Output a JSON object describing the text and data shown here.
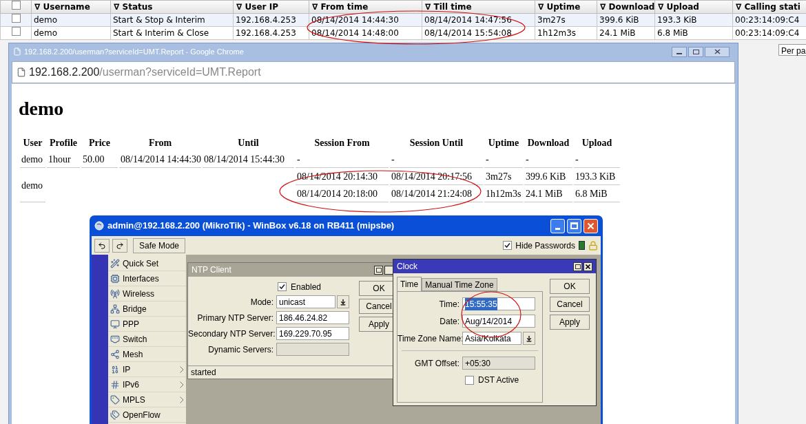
{
  "user_list": {
    "header_checkbox": {
      "checked": false
    },
    "columns": [
      "∇ Username",
      "∇ Status",
      "∇ User IP",
      "∇ From time",
      "∇ Till time",
      "∇ Uptime",
      "∇ Download",
      "∇ Upload",
      "∇ Calling stati"
    ],
    "rows": [
      {
        "checked": false,
        "cells": [
          "demo",
          "Start & Stop & Interim",
          "192.168.4.253",
          "08/14/2014 14:44:30",
          "08/14/2014 14:47:56",
          "3m27s",
          "399.6 KiB",
          "193.3 KiB",
          "00:23:14:09:C4"
        ]
      },
      {
        "checked": false,
        "cells": [
          "demo",
          "Start & Interim & Close",
          "192.168.4.253",
          "08/14/2014 14:48:00",
          "08/14/2014 15:54:08",
          "1h12m3s",
          "24.1 MiB",
          "6.8 MiB",
          "00:23:14:09:C4"
        ]
      }
    ]
  },
  "side_panel": {
    "per_page": "Per pa"
  },
  "browser": {
    "title": "192.168.2.200/userman?serviceId=UMT.Report - Google Chrome",
    "address": {
      "host": "192.168.2.200",
      "path": "/userman?serviceId=UMT.Report"
    },
    "report": {
      "heading": "demo",
      "columns": [
        "User",
        "Profile",
        "Price",
        "From",
        "Until",
        "Session From",
        "Session Until",
        "Uptime",
        "Download",
        "Upload"
      ],
      "rows": [
        {
          "user": "demo",
          "profile": "1hour",
          "price": "50.00",
          "from": "08/14/2014 14:44:30",
          "until": "08/14/2014 15:44:30",
          "sessions": [
            {
              "from": "-",
              "until": "-",
              "uptime": "-",
              "download": "-",
              "upload": "-"
            }
          ]
        },
        {
          "user": "demo",
          "sessions": [
            {
              "from": "08/14/2014 20:14:30",
              "until": "08/14/2014 20:17:56",
              "uptime": "3m27s",
              "download": "399.6 KiB",
              "upload": "193.3 KiB"
            },
            {
              "from": "08/14/2014 20:18:00",
              "until": "08/14/2014 21:24:08",
              "uptime": "1h12m3s",
              "download": "24.1 MiB",
              "upload": "6.8 MiB"
            }
          ]
        }
      ]
    }
  },
  "winbox": {
    "title": "admin@192.168.2.200 (MikroTik) - WinBox v6.18 on RB411 (mipsbe)",
    "safe_mode": "Safe Mode",
    "hide_passwords": {
      "label": "Hide Passwords",
      "checked": true
    },
    "menu": [
      {
        "label": "Quick Set",
        "submenu": false
      },
      {
        "label": "Interfaces",
        "submenu": false
      },
      {
        "label": "Wireless",
        "submenu": false
      },
      {
        "label": "Bridge",
        "submenu": false
      },
      {
        "label": "PPP",
        "submenu": false
      },
      {
        "label": "Switch",
        "submenu": false
      },
      {
        "label": "Mesh",
        "submenu": false
      },
      {
        "label": "IP",
        "submenu": true
      },
      {
        "label": "IPv6",
        "submenu": true
      },
      {
        "label": "MPLS",
        "submenu": true
      },
      {
        "label": "OpenFlow",
        "submenu": false
      }
    ],
    "ntp_client": {
      "title": "NTP Client",
      "enabled": {
        "label": "Enabled",
        "checked": true
      },
      "fields": [
        {
          "kind": "select",
          "label": "Mode:",
          "value": "unicast"
        },
        {
          "kind": "text",
          "label": "Primary NTP Server:",
          "value": "186.46.24.82"
        },
        {
          "kind": "text",
          "label": "Secondary NTP Server:",
          "value": "169.229.70.95"
        },
        {
          "kind": "readonly",
          "label": "Dynamic Servers:"
        }
      ],
      "buttons": [
        "OK",
        "Cancel",
        "Apply"
      ],
      "status": "started"
    },
    "clock": {
      "title": "Clock",
      "tabs": [
        {
          "label": "Time",
          "selected": true
        },
        {
          "label": "Manual Time Zone",
          "selected": false
        }
      ],
      "fields": [
        {
          "kind": "text",
          "label": "Time:",
          "value": "15:55:35",
          "text_selected": true
        },
        {
          "kind": "text",
          "label": "Date:",
          "value": "Aug/14/2014",
          "text_selected": false
        },
        {
          "kind": "select",
          "label": "Time Zone Name:",
          "value": "Asia/Kolkata"
        },
        {
          "kind": "separator"
        },
        {
          "kind": "readonly",
          "label": "GMT Offset:",
          "value": "+05:30"
        },
        {
          "kind": "checkbox",
          "label": "DST Active",
          "checked": false
        }
      ],
      "buttons": [
        "OK",
        "Cancel",
        "Apply"
      ]
    }
  }
}
